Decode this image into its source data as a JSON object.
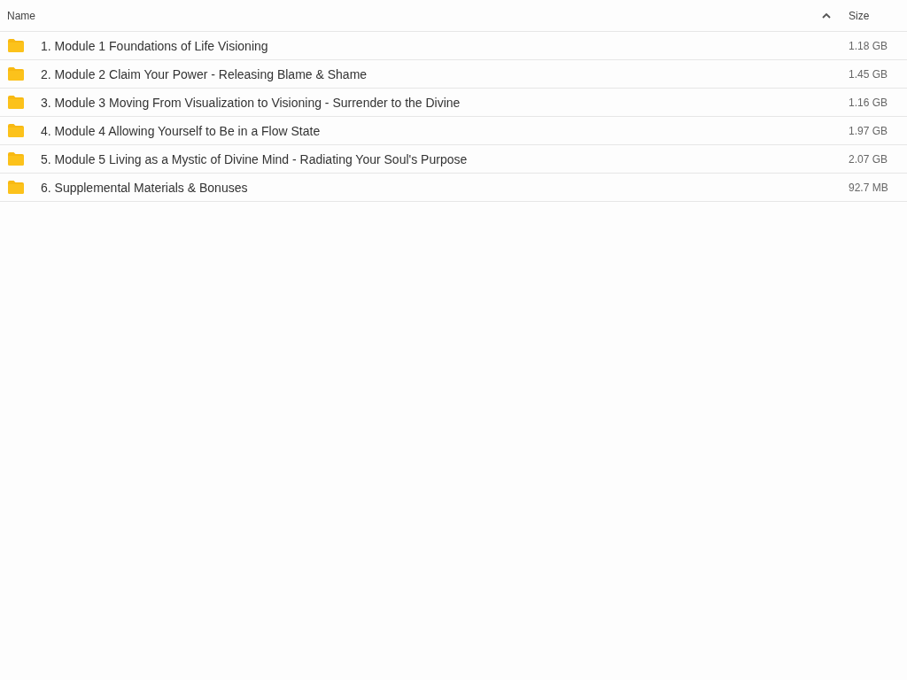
{
  "table": {
    "columns": [
      {
        "label": "Name",
        "sorted": true
      },
      {
        "label": "Size",
        "sorted": false
      }
    ],
    "rows": [
      {
        "kind": "folder",
        "name": "1. Module 1 Foundations of Life Visioning",
        "size": "1.18 GB"
      },
      {
        "kind": "folder",
        "name": "2. Module 2 Claim Your Power - Releasing Blame & Shame",
        "size": "1.45 GB"
      },
      {
        "kind": "folder",
        "name": "3. Module 3 Moving From Visualization to Visioning - Surrender to the Divine",
        "size": "1.16 GB"
      },
      {
        "kind": "folder",
        "name": "4. Module 4 Allowing Yourself to Be in a Flow State",
        "size": "1.97 GB"
      },
      {
        "kind": "folder",
        "name": "5. Module 5 Living as a Mystic of Divine Mind - Radiating Your Soul's Purpose",
        "size": "2.07 GB"
      },
      {
        "kind": "folder",
        "name": "6. Supplemental Materials & Bonuses",
        "size": "92.7 MB"
      }
    ]
  }
}
